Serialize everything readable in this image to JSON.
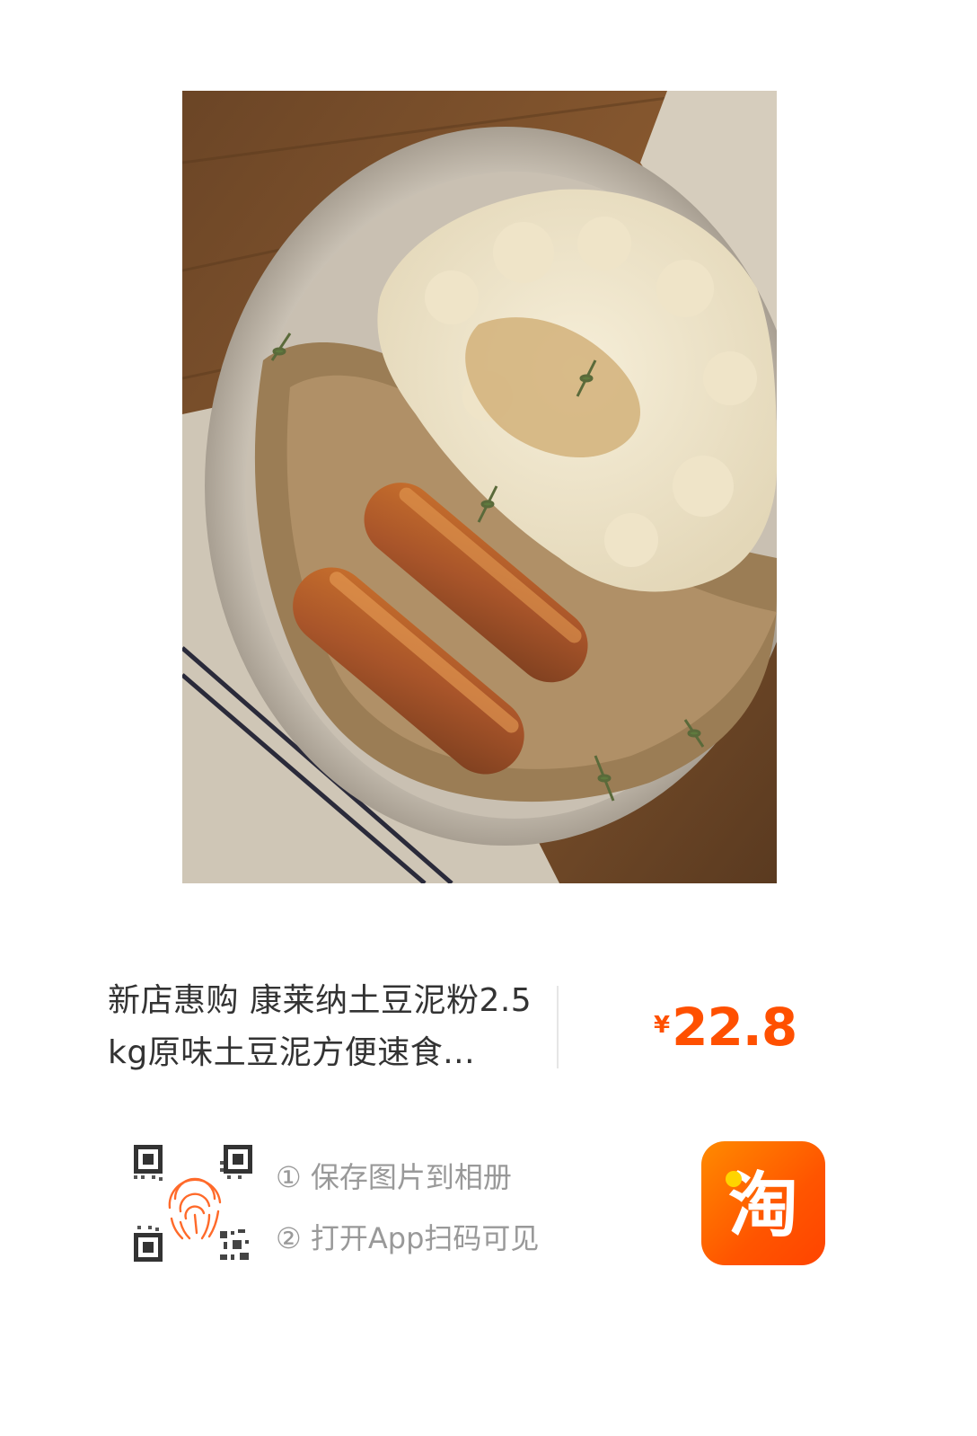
{
  "product": {
    "image_alt": "sausages with mashed potatoes and gravy",
    "title": "新店惠购 康莱纳土豆泥粉2.5kg原味土豆泥方便速食...",
    "price_currency": "¥",
    "price_value": "22.8"
  },
  "share": {
    "step1": "① 保存图片到相册",
    "step2": "② 打开App扫码可见"
  },
  "app": {
    "icon_glyph": "淘",
    "name": "taobao-app-icon"
  },
  "colors": {
    "price": "#ff5000",
    "brand_orange": "#ff5500",
    "title_text": "#333333",
    "step_text": "#999999"
  }
}
